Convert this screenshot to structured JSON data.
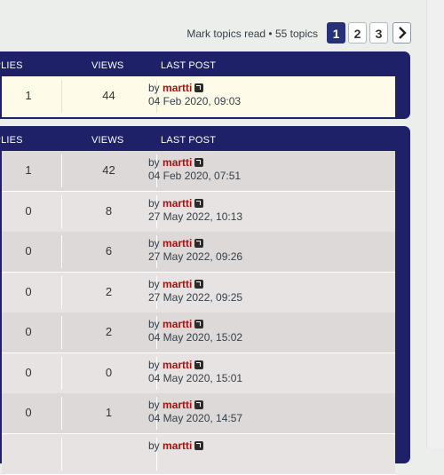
{
  "pagination": {
    "mark_read": "Mark topics read",
    "separator": " • ",
    "topic_count": "55 topics",
    "pages": [
      "1",
      "2",
      "3"
    ],
    "active_page": "1",
    "next_icon": "chevron-right-icon"
  },
  "columns": {
    "replies": "EPLIES",
    "views": "VIEWS",
    "last_post": "LAST POST"
  },
  "by_label": "by",
  "sticky_topics": [
    {
      "replies": "1",
      "views": "44",
      "author": "martti",
      "date": "04 Feb 2020, 09:03"
    }
  ],
  "topics": [
    {
      "replies": "1",
      "views": "42",
      "author": "martti",
      "date": "04 Feb 2020, 07:51"
    },
    {
      "replies": "0",
      "views": "8",
      "author": "martti",
      "date": "27 May 2022, 10:13"
    },
    {
      "replies": "0",
      "views": "6",
      "author": "martti",
      "date": "27 May 2022, 09:26"
    },
    {
      "replies": "0",
      "views": "2",
      "author": "martti",
      "date": "27 May 2022, 09:25"
    },
    {
      "replies": "0",
      "views": "2",
      "author": "martti",
      "date": "04 May 2020, 15:02"
    },
    {
      "replies": "0",
      "views": "0",
      "author": "martti",
      "date": "04 May 2020, 15:01"
    },
    {
      "replies": "0",
      "views": "1",
      "author": "martti",
      "date": "04 May 2020, 14:57"
    },
    {
      "replies": "",
      "views": "",
      "author": "martti",
      "date": ""
    }
  ],
  "colors": {
    "header": "#1e2168",
    "author": "#a6120f",
    "sticky_row": "#fefce9",
    "row_odd": "#e6e3e2",
    "row_even": "#dcd9d8"
  }
}
